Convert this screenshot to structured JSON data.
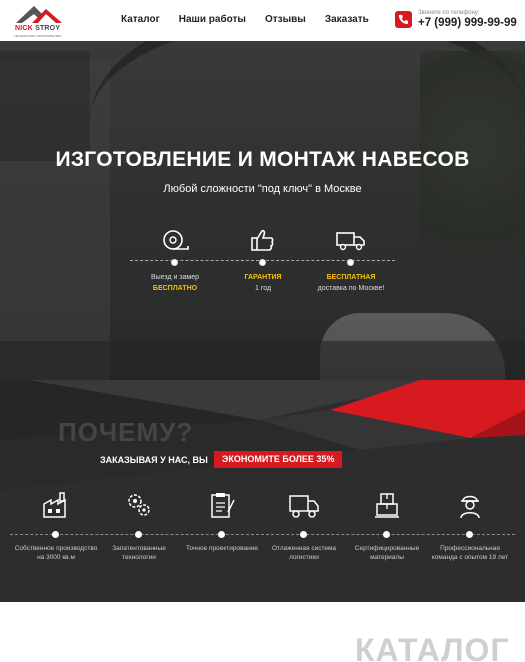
{
  "logo": {
    "part1": "NICK",
    "part2": "STROY",
    "tagline": "ТЕХНОЛОГИИ СТРОИТЕЛЬСТВА",
    "colors": {
      "red": "#d71920",
      "gray": "#555555"
    }
  },
  "nav": [
    "Каталог",
    "Наши работы",
    "Отзывы",
    "Заказать"
  ],
  "phone": {
    "caption": "Звоните по телефону:",
    "number": "+7 (999) 999-99-99",
    "icon": "phone-icon"
  },
  "hero": {
    "title": "ИЗГОТОВЛЕНИЕ И МОНТАЖ НАВЕСОВ",
    "subtitle": "Любой сложности \"под ключ\" в Москве",
    "features": [
      {
        "icon": "tape-measure-icon",
        "line1": "Выезд и замер",
        "line2": "БЕСПЛАТНО",
        "accent_line": 2
      },
      {
        "icon": "thumbs-up-icon",
        "line1": "ГАРАНТИЯ",
        "line2": "1 год",
        "accent_line": 1
      },
      {
        "icon": "truck-icon",
        "line1": "БЕСПЛАТНАЯ",
        "line2": "доставка по Москве!",
        "accent_line": 1
      }
    ]
  },
  "why": {
    "ghost": "ПОЧЕМУ?",
    "lead": "ЗАКАЗЫВАЯ У НАС, ВЫ",
    "badge": "ЭКОНОМИТЕ БОЛЕЕ 35%",
    "items": [
      {
        "icon": "factory-icon",
        "text": "Собственное производство на 3000 кв.м"
      },
      {
        "icon": "gears-icon",
        "text": "Запатентованные технологии"
      },
      {
        "icon": "clipboard-icon",
        "text": "Точное проектирование"
      },
      {
        "icon": "truck-icon",
        "text": "Отлаженная система логистики"
      },
      {
        "icon": "boxes-icon",
        "text": "Сертифицированные материалы"
      },
      {
        "icon": "worker-icon",
        "text": "Профессиональная команда с опытом 19 лет"
      }
    ]
  },
  "catalog": {
    "title": "КАТАЛОГ"
  },
  "colors": {
    "accent": "#d71920",
    "yellow": "#f5c000",
    "dark": "#2d2d2d"
  }
}
